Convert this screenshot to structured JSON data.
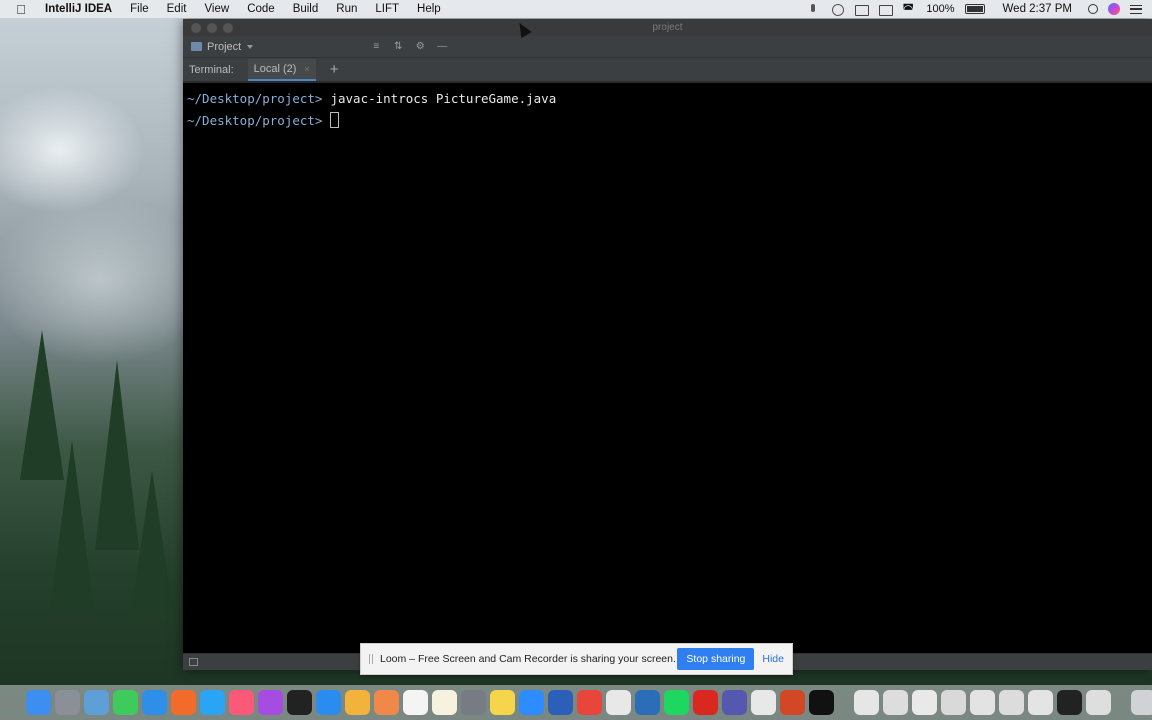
{
  "menubar": {
    "app_name": "IntelliJ IDEA",
    "items": [
      "File",
      "Edit",
      "View",
      "Code",
      "Build",
      "Run",
      "LIFT",
      "Help"
    ],
    "battery": "100%",
    "clock": "Wed 2:37 PM"
  },
  "window": {
    "title": "project"
  },
  "toolbar": {
    "project_label": "Project"
  },
  "terminal_bar": {
    "label": "Terminal:",
    "tab_label": "Local (2)",
    "tab_close": "×",
    "add": "+"
  },
  "terminal": {
    "lines": [
      {
        "prompt": "~/Desktop/project>",
        "command": "javac-introcs PictureGame.java"
      },
      {
        "prompt": "~/Desktop/project>",
        "command": ""
      }
    ]
  },
  "loom": {
    "message": "Loom – Free Screen and Cam Recorder is sharing your screen.",
    "stop_label": "Stop sharing",
    "hide_label": "Hide"
  },
  "dock": {
    "apps": [
      {
        "name": "finder-icon",
        "color": "#3d8ef0"
      },
      {
        "name": "launchpad-icon",
        "color": "#8a8f98"
      },
      {
        "name": "preview-icon",
        "color": "#5e9fd8"
      },
      {
        "name": "messages-icon",
        "color": "#3ecb5b"
      },
      {
        "name": "safari-icon",
        "color": "#2f8ee8"
      },
      {
        "name": "firefox-icon",
        "color": "#f26b2a"
      },
      {
        "name": "chat-icon",
        "color": "#2aa4f4"
      },
      {
        "name": "music-icon",
        "color": "#fa5a78"
      },
      {
        "name": "podcasts-icon",
        "color": "#a74ce0"
      },
      {
        "name": "appletv-icon",
        "color": "#222222"
      },
      {
        "name": "appstore-icon",
        "color": "#2b8cf0"
      },
      {
        "name": "photos-icon",
        "color": "#f2b33d"
      },
      {
        "name": "pinwheel-icon",
        "color": "#f0884a"
      },
      {
        "name": "calendar-icon",
        "color": "#f4f4f4"
      },
      {
        "name": "notes-icon",
        "color": "#f7f2e0"
      },
      {
        "name": "settings-icon",
        "color": "#777c84"
      },
      {
        "name": "stickies-icon",
        "color": "#f6d54b"
      },
      {
        "name": "zoom-icon",
        "color": "#2d8cff"
      },
      {
        "name": "word-icon",
        "color": "#2b5fb8"
      },
      {
        "name": "chrome-icon",
        "color": "#e8463a"
      },
      {
        "name": "blocked-icon",
        "color": "#e8e8e8"
      },
      {
        "name": "bluejay-icon",
        "color": "#2c6db8"
      },
      {
        "name": "spotify-icon",
        "color": "#1ed760"
      },
      {
        "name": "acrobat-icon",
        "color": "#d8281f"
      },
      {
        "name": "teams-icon",
        "color": "#5558af"
      },
      {
        "name": "slack-icon",
        "color": "#e8e8e8"
      },
      {
        "name": "powerpoint-icon",
        "color": "#d24726"
      },
      {
        "name": "intellij-icon",
        "color": "#111111"
      },
      {
        "name": "doc-thumb-1-icon",
        "color": "#e6e6e6"
      },
      {
        "name": "doc-thumb-2-icon",
        "color": "#dddddd"
      },
      {
        "name": "doc-thumb-3-icon",
        "color": "#e9e9e9"
      },
      {
        "name": "doc-thumb-4-icon",
        "color": "#d9d9d9"
      },
      {
        "name": "doc-thumb-5-icon",
        "color": "#e3e3e3"
      },
      {
        "name": "doc-thumb-6-icon",
        "color": "#dcdcdc"
      },
      {
        "name": "doc-thumb-7-icon",
        "color": "#e4e4e4"
      },
      {
        "name": "terminal-thumb-icon",
        "color": "#222222"
      },
      {
        "name": "doc-thumb-8-icon",
        "color": "#dedede"
      },
      {
        "name": "trash-icon",
        "color": "#cfd3d6"
      }
    ]
  },
  "colors": {
    "terminal_bg": "#000000",
    "prompt": "#87afd7",
    "accent": "#2f7ff0"
  }
}
